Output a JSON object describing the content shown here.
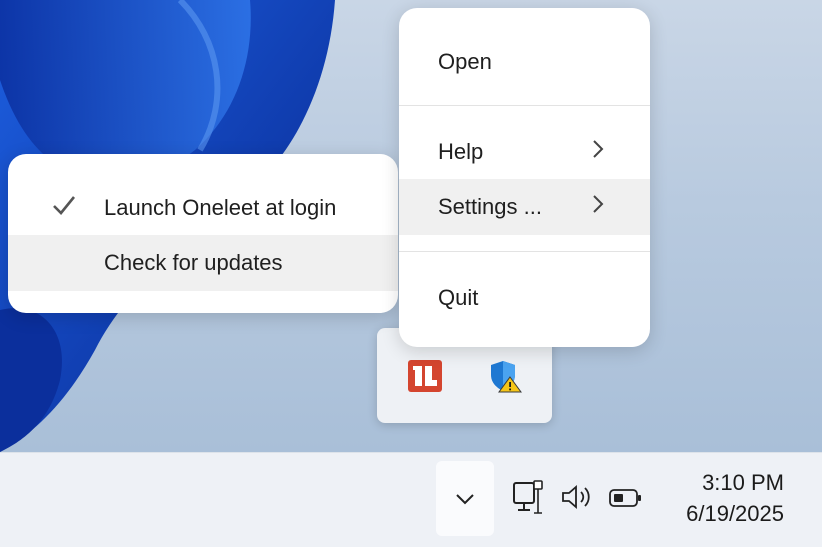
{
  "main_menu": {
    "items": [
      {
        "label": "Open"
      },
      {
        "label": "Help"
      },
      {
        "label": "Settings ..."
      },
      {
        "label": "Quit"
      }
    ]
  },
  "settings_submenu": {
    "items": [
      {
        "label": "Launch Oneleet at login",
        "checked": true
      },
      {
        "label": "Check for updates"
      }
    ]
  },
  "tray": {
    "icons": [
      "oneleet-app-icon",
      "windows-security-warning-icon"
    ],
    "oneleet_logo_text": "1L"
  },
  "taskbar": {
    "clock": {
      "time": "3:10 PM",
      "date": "6/19/2025"
    },
    "icons": [
      "show-hidden-icons-chevron",
      "network-icon",
      "volume-icon",
      "battery-icon"
    ]
  },
  "colors": {
    "oneleet_brand": "#d4452f",
    "shield_blue": "#1e78d2",
    "warning_yellow": "#f5c518",
    "menu_hover": "#f0f0f0",
    "wallpaper_blue": "#0c3fb8"
  }
}
